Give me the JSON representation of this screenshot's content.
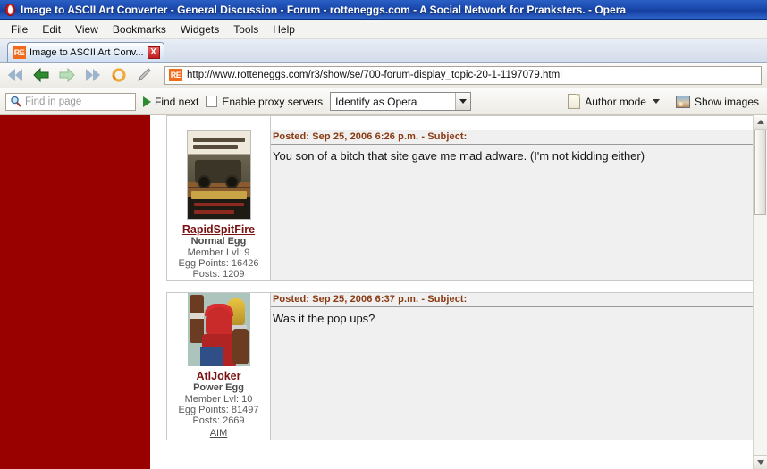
{
  "window": {
    "title": "Image to ASCII Art Converter - General Discussion - Forum - rotteneggs.com - A Social Network for Pranksters. - Opera",
    "logo_icon": "opera-logo-icon"
  },
  "menubar": {
    "items": [
      {
        "label": "File"
      },
      {
        "label": "Edit"
      },
      {
        "label": "View"
      },
      {
        "label": "Bookmarks"
      },
      {
        "label": "Widgets"
      },
      {
        "label": "Tools"
      },
      {
        "label": "Help"
      }
    ]
  },
  "tabs": [
    {
      "favicon_text": "RE",
      "favicon_icon": "rotteneggs-favicon",
      "title": "Image to ASCII Art Conv...",
      "close_label": "X",
      "close_icon": "close-icon"
    }
  ],
  "navbar": {
    "buttons": [
      {
        "name": "rewind-button",
        "icon": "rewind-icon"
      },
      {
        "name": "back-button",
        "icon": "back-arrow-icon"
      },
      {
        "name": "forward-button",
        "icon": "forward-arrow-icon"
      },
      {
        "name": "fast-forward-button",
        "icon": "fast-forward-icon"
      },
      {
        "name": "reload-button",
        "icon": "reload-icon"
      },
      {
        "name": "edit-button",
        "icon": "pencil-icon"
      }
    ],
    "address": {
      "favicon_text": "RE",
      "favicon_icon": "rotteneggs-favicon",
      "url": "http://www.rotteneggs.com/r3/show/se/700-forum-display_topic-20-1-1197079.html"
    }
  },
  "findbar": {
    "search_icon": "magnifier-icon",
    "find_placeholder": "Find in page",
    "find_value": "",
    "find_next_label": "Find next",
    "find_next_icon": "play-icon",
    "proxy_label": "Enable proxy servers",
    "proxy_checked": false,
    "identify_value": "Identify as Opera",
    "identify_icon": "chevron-down-icon",
    "author_mode_label": "Author mode",
    "author_mode_icon": "page-icon",
    "author_mode_caret": "chevron-down-icon",
    "show_images_label": "Show images",
    "show_images_icon": "image-icon"
  },
  "page": {
    "sidebar_color": "#990000",
    "posts": [
      {
        "avatar_alt": "solo-driver-bob-poster",
        "username": "RapidSpitFire",
        "rank": "Normal Egg",
        "member_lvl": "Member Lvl: 9",
        "egg_points": "Egg Points: 16426",
        "posts_count": "Posts: 1209",
        "aim": "",
        "posted": "Posted: Sep 25, 2006 6:26 p.m. - Subject:",
        "body": "You son of a bitch that site gave me mad adware. (I'm not kidding either)"
      },
      {
        "avatar_alt": "atljoker-character-avatar",
        "username": "AtlJoker",
        "rank": "Power Egg",
        "member_lvl": "Member Lvl: 10",
        "egg_points": "Egg Points: 81497",
        "posts_count": "Posts: 2669",
        "aim": "AIM",
        "posted": "Posted: Sep 25, 2006 6:37 p.m. - Subject:",
        "body": "Was it the pop ups?"
      }
    ]
  }
}
